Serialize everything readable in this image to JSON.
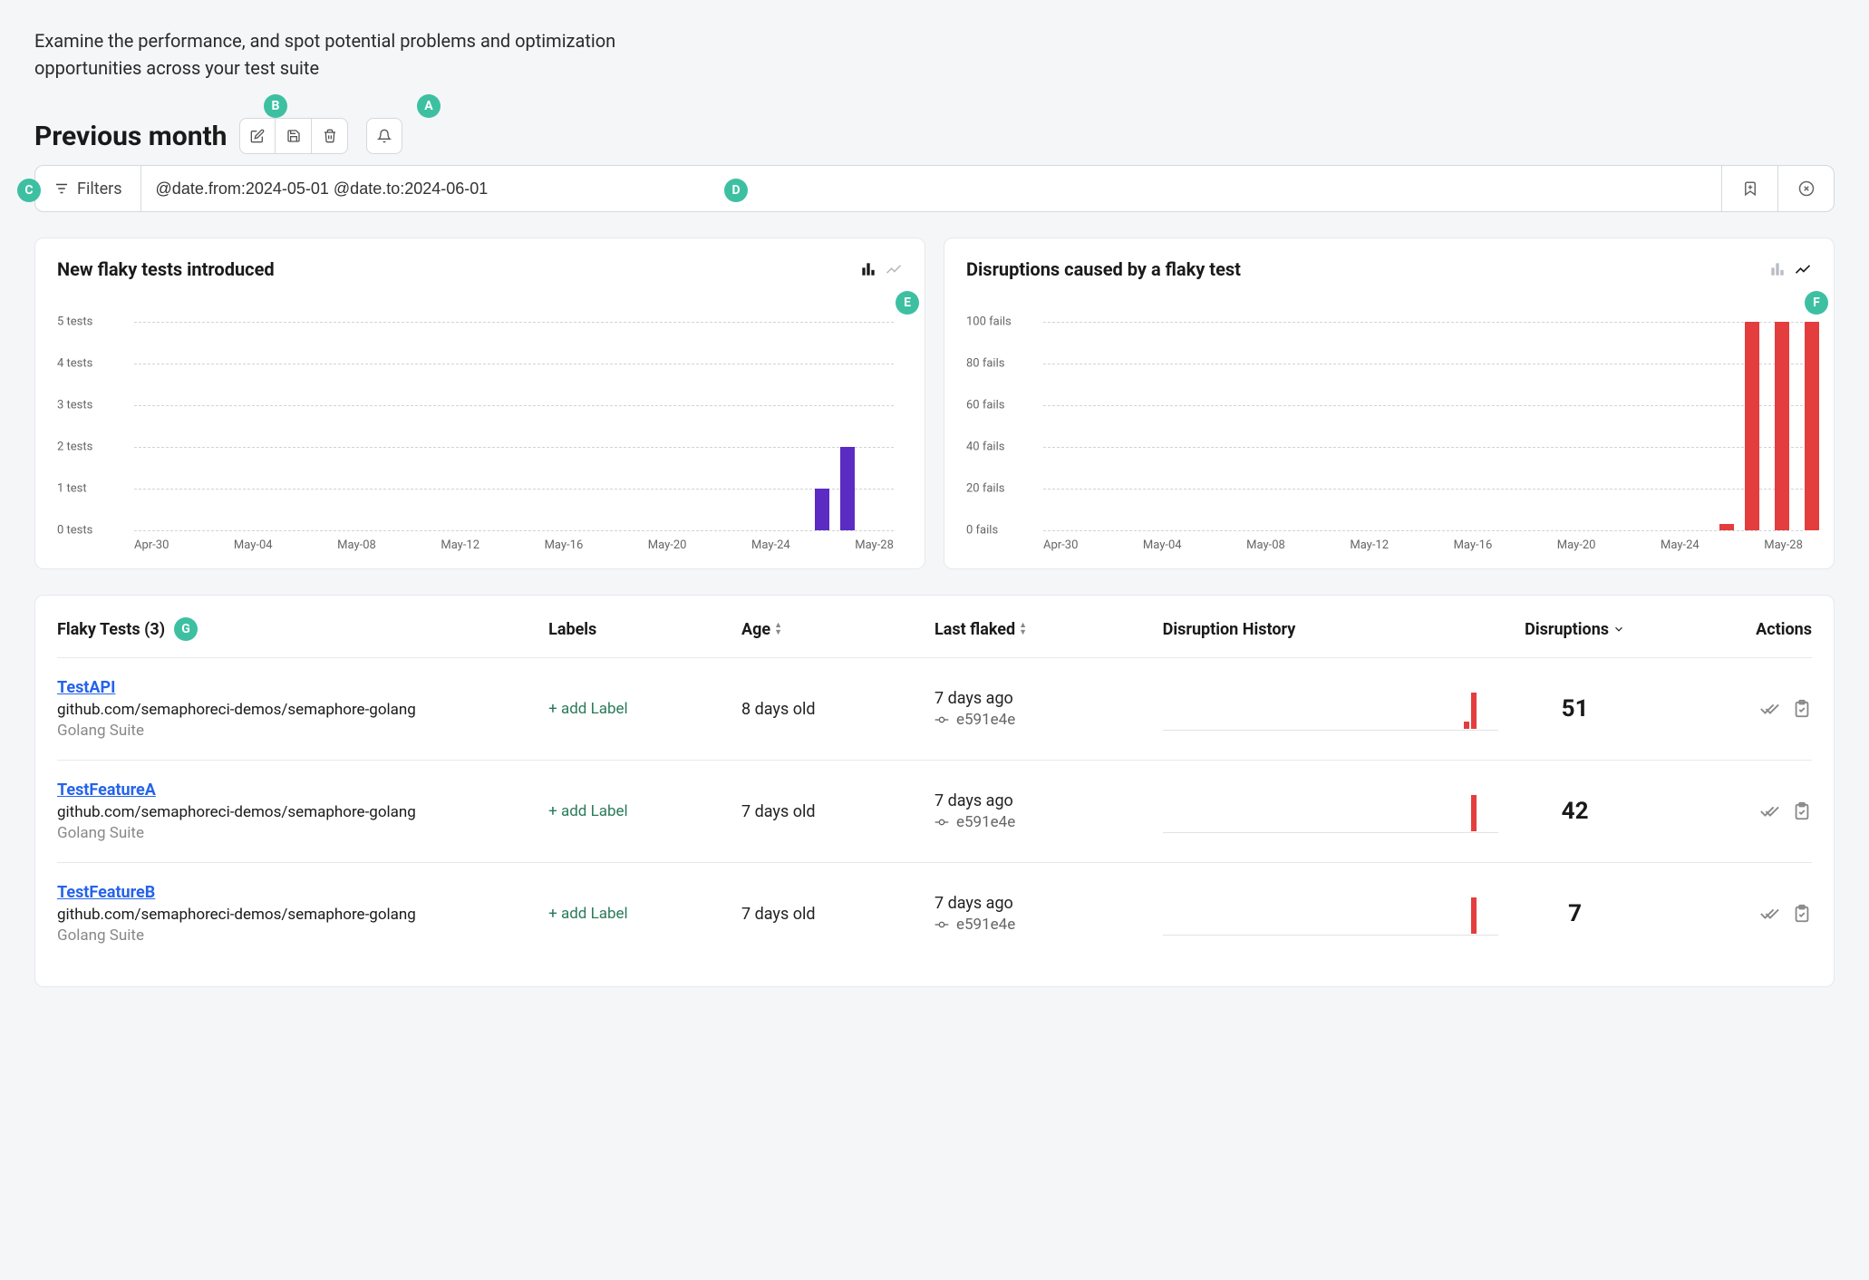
{
  "page": {
    "description": "Examine the performance, and spot potential problems and optimization opportunities across your test suite",
    "title": "Previous month"
  },
  "badges": {
    "b": "B",
    "a": "A",
    "c": "C",
    "d": "D",
    "e": "E",
    "f": "F",
    "g": "G"
  },
  "filter": {
    "label": "Filters",
    "query": "@date.from:2024-05-01 @date.to:2024-06-01"
  },
  "chart1": {
    "title": "New flaky tests introduced",
    "ylabels": [
      "5 tests",
      "4 tests",
      "3 tests",
      "2 tests",
      "1 test",
      "0 tests"
    ],
    "xlabels": [
      "Apr-30",
      "May-04",
      "May-08",
      "May-12",
      "May-16",
      "May-20",
      "May-24",
      "May-28"
    ]
  },
  "chart2": {
    "title": "Disruptions caused by a flaky test",
    "ylabels": [
      "100 fails",
      "80 fails",
      "60 fails",
      "40 fails",
      "20 fails",
      "0 fails"
    ],
    "xlabels": [
      "Apr-30",
      "May-04",
      "May-08",
      "May-12",
      "May-16",
      "May-20",
      "May-24",
      "May-28"
    ]
  },
  "table": {
    "title": "Flaky Tests (3)",
    "headers": {
      "labels": "Labels",
      "age": "Age",
      "last_flaked": "Last flaked",
      "history": "Disruption History",
      "disruptions": "Disruptions",
      "actions": "Actions"
    },
    "add_label": "+ add Label",
    "rows": [
      {
        "name": "TestAPI",
        "path": "github.com/semaphoreci-demos/semaphore-golang",
        "suite": "Golang Suite",
        "age": "8 days old",
        "last_flaked": "7 days ago",
        "commit": "e591e4e",
        "disruptions": "51"
      },
      {
        "name": "TestFeatureA",
        "path": "github.com/semaphoreci-demos/semaphore-golang",
        "suite": "Golang Suite",
        "age": "7 days old",
        "last_flaked": "7 days ago",
        "commit": "e591e4e",
        "disruptions": "42"
      },
      {
        "name": "TestFeatureB",
        "path": "github.com/semaphoreci-demos/semaphore-golang",
        "suite": "Golang Suite",
        "age": "7 days old",
        "last_flaked": "7 days ago",
        "commit": "e591e4e",
        "disruptions": "7"
      }
    ]
  },
  "chart_data": [
    {
      "type": "bar",
      "title": "New flaky tests introduced",
      "categories": [
        "Apr-30",
        "May-04",
        "May-08",
        "May-12",
        "May-16",
        "May-20",
        "May-24",
        "May-28"
      ],
      "values_by_date": {
        "May-27": 1,
        "May-28": 2
      },
      "ylabel": "tests",
      "ylim": [
        0,
        5
      ],
      "color": "#5b2bc4"
    },
    {
      "type": "bar",
      "title": "Disruptions caused by a flaky test",
      "categories": [
        "Apr-30",
        "May-04",
        "May-08",
        "May-12",
        "May-16",
        "May-20",
        "May-24",
        "May-28"
      ],
      "values_by_date": {
        "May-27": 3,
        "May-28": 100,
        "May-29": 100,
        "May-30": 100
      },
      "ylabel": "fails",
      "ylim": [
        0,
        100
      ],
      "color": "#e43d3d"
    }
  ]
}
